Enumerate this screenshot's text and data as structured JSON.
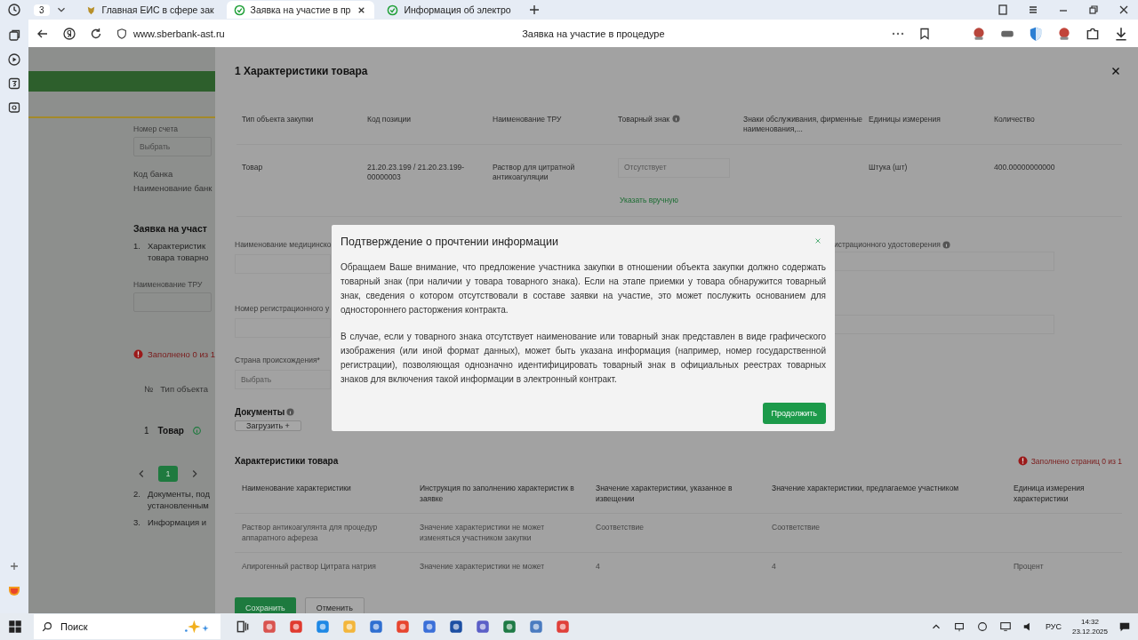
{
  "browser": {
    "tab_count": "3",
    "tabs": [
      {
        "title": "Главная ЕИС в сфере зак",
        "selected": false,
        "kind": "emblem"
      },
      {
        "title": "Заявка на участие в пр",
        "selected": true,
        "kind": "check"
      },
      {
        "title": "Информация об электро",
        "selected": false,
        "kind": "check"
      }
    ],
    "url": "www.sberbank-ast.ru",
    "page_title": "Заявка на участие в процедуре"
  },
  "page": {
    "account_label": "Номер счета",
    "account_placeholder": "Выбрать",
    "bank_code_label": "Код банка",
    "bank_name_label": "Наименование банк",
    "section_title": "Заявка на участ",
    "item_1": {
      "number": "1.",
      "lines": [
        "Характеристик",
        "товара товарно"
      ]
    },
    "tru_label": "Наименование ТРУ",
    "filled_status": "Заполнено 0 из 1",
    "table_header": [
      "№",
      "Тип объекта"
    ],
    "row": {
      "number": "1",
      "type": "Товар"
    },
    "pages": [
      {
        "label": "1",
        "selected": true
      }
    ],
    "item_2": {
      "number": "2.",
      "lines": [
        "Документы, под",
        "установленным"
      ]
    },
    "item_3": {
      "number": "3.",
      "lines": [
        "Информация и"
      ]
    }
  },
  "panel": {
    "title": "1 Характеристики товара",
    "product_columns": [
      "Тип объекта закупки",
      "Код позиции",
      "Наименование ТРУ",
      "Товарный знак",
      "Знаки обслуживания, фирменные наименования,...",
      "Единицы измерения",
      "Количество"
    ],
    "product_row": {
      "type": "Товар",
      "code": "21.20.23.199 / 21.20.23.199-00000003",
      "name": "Раствор для цитратной антикоагуляции",
      "trademark_placeholder": "Отсутствует",
      "trademark_link": "Указать вручную",
      "unit": "Штука (шт)",
      "quantity": "400.00000000000"
    },
    "left_labels": [
      "Наименование медицинско",
      "Номер регистрационного у"
    ],
    "right_label": "истрационного удостоверения",
    "country_label": "Страна происхождения*",
    "country_placeholder": "Выбрать",
    "documents_title": "Документы",
    "upload_button": "Загрузить +",
    "chars_title": "Характеристики товара",
    "chars_status": "Заполнено страниц 0 из 1",
    "chars_columns": [
      "Наименование характеристики",
      "Инструкция по заполнению характеристик в заявке",
      "Значение характеристики, указанное в извещении",
      "Значение характеристики, предлагаемое участником",
      "Единица измерения характеристики"
    ],
    "chars_rows": [
      [
        "Раствор антикоагулянта для процедур аппаратного афереза",
        "Значение характеристики не может изменяться участником закупки",
        "Соответствие",
        "Соответствие",
        ""
      ],
      [
        "Апирогенный раствор Цитрата натрия",
        "Значение характеристики не может",
        "4",
        "4",
        "Процент"
      ]
    ],
    "save_button": "Сохранить",
    "cancel_button": "Отменить"
  },
  "dialog": {
    "title": "Подтверждение о прочтении информации",
    "paragraphs": [
      "Обращаем Ваше внимание, что предложение участника закупки в отношении объекта закупки должно содержать товарный знак (при наличии у товара товарного знака). Если на этапе приемки у товара обнаружится товарный знак, сведения о котором отсутствовали в составе заявки на участие, это может послужить основанием для одностороннего расторжения контракта.",
      "В случае, если у товарного знака отсутствует наименование или товарный знак представлен в виде графического изображения (или иной формат данных), может быть указана информация (например, номер государственной регистрации), позволяющая однозначно идентифицировать товарный знак в официальных реестрах товарных знаков для включения такой информации в электронный контракт."
    ],
    "continue_button": "Продолжить"
  },
  "taskbar": {
    "search": "Поиск",
    "language": "РУС",
    "time": "14:32",
    "date": "23.12.2025"
  }
}
